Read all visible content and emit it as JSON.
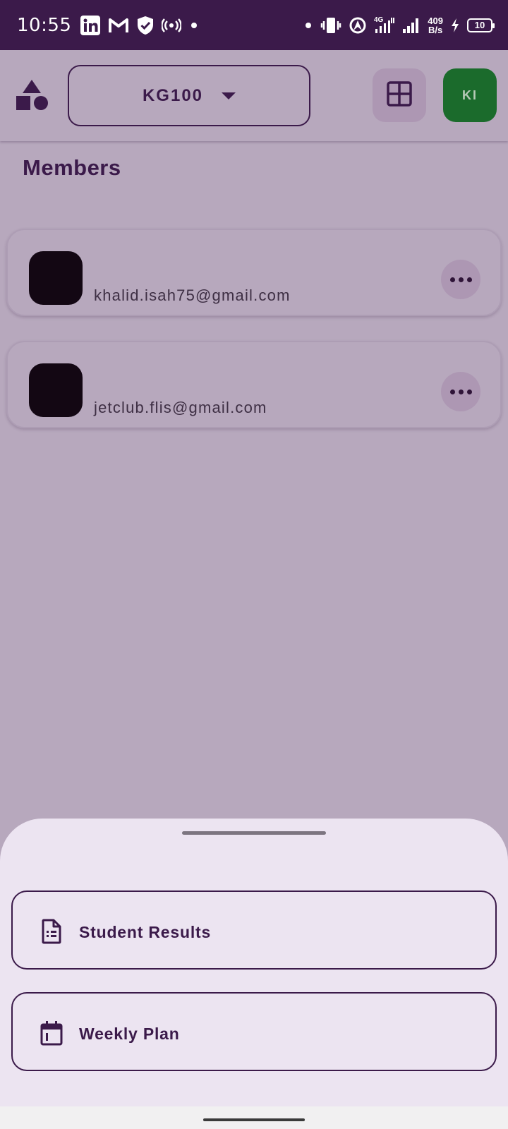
{
  "status_bar": {
    "time": "10:55",
    "left_icons": [
      "linkedin-icon",
      "gmail-icon",
      "shield-check-icon",
      "hotspot-icon",
      "dot-icon"
    ],
    "network_type": "4G",
    "speed_value": "409",
    "speed_unit": "B/s",
    "battery": "10"
  },
  "app_bar": {
    "logo_icon": "shapes-logo-icon",
    "class_selector": "KG100",
    "grid_icon": "grid-view-icon",
    "avatar_initials": "KI",
    "avatar_color": "#1b6b2c"
  },
  "members": {
    "title": "Members",
    "items": [
      {
        "email": "khalid.isah75@gmail.com"
      },
      {
        "email": "jetclub.flis@gmail.com"
      }
    ]
  },
  "bottom_sheet": {
    "options": [
      {
        "label": "Student Results",
        "icon": "document-list-icon"
      },
      {
        "label": "Weekly Plan",
        "icon": "calendar-icon"
      }
    ]
  },
  "colors": {
    "primary": "#3b1a4a",
    "scrim_background": "#b7a8bd",
    "sheet_background": "#ece4f1"
  }
}
